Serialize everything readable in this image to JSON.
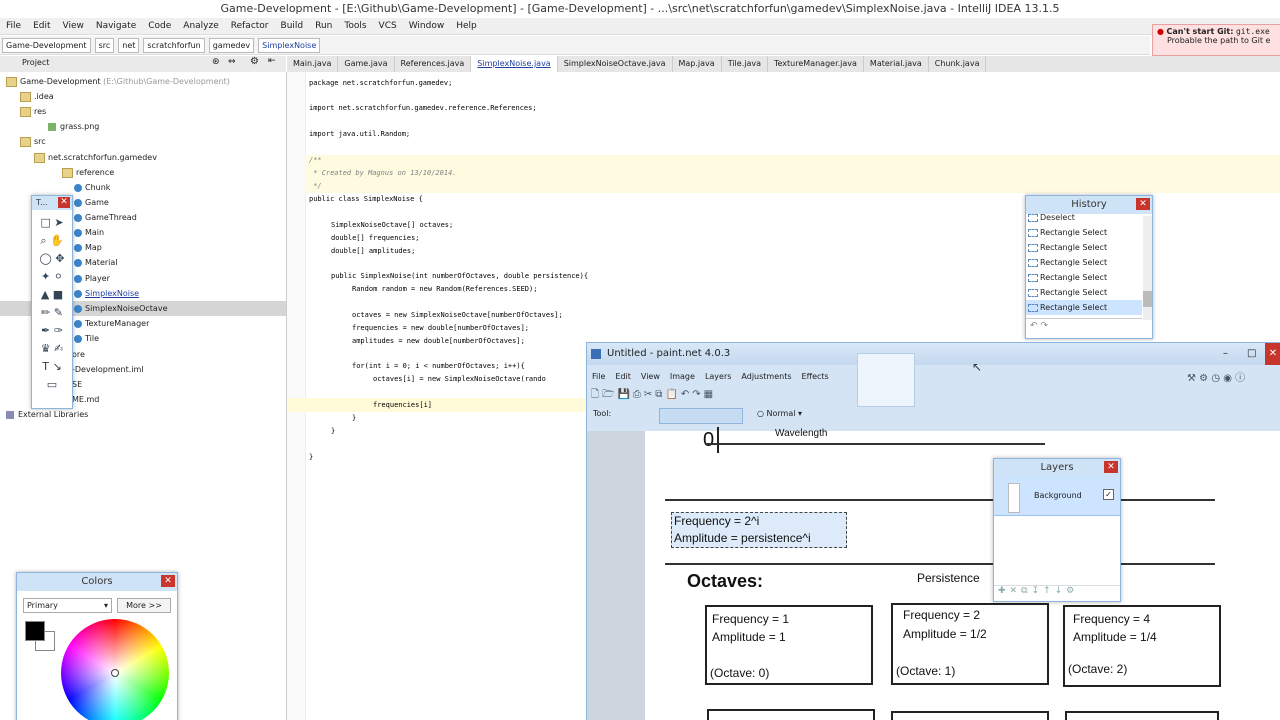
{
  "intellij": {
    "title": "Game-Development - [E:\\Github\\Game-Development] - [Game-Development] - ...\\src\\net\\scratchforfun\\gamedev\\SimplexNoise.java - IntelliJ IDEA 13.1.5",
    "menu": [
      "File",
      "Edit",
      "View",
      "Navigate",
      "Code",
      "Analyze",
      "Refactor",
      "Build",
      "Run",
      "Tools",
      "VCS",
      "Window",
      "Help"
    ],
    "breadcrumbs": [
      "Game-Development",
      "src",
      "net",
      "scratchforfun",
      "gamedev",
      "SimplexNoise"
    ],
    "git_error": {
      "title": "Can't start Git:",
      "detail": "Probable the path to Git e",
      "code": "git.exe"
    },
    "project_label": "Project",
    "tree": [
      {
        "label": "Game-Development",
        "extra": "(E:\\Github\\Game-Development)",
        "type": "folder"
      },
      {
        "label": ".idea",
        "type": "folder"
      },
      {
        "label": "res",
        "type": "folder"
      },
      {
        "label": "grass.png",
        "type": "file"
      },
      {
        "label": "src",
        "type": "folder"
      },
      {
        "label": "net.scratchforfun.gamedev",
        "type": "folder"
      },
      {
        "label": "reference",
        "type": "folder"
      },
      {
        "label": "Chunk",
        "type": "class"
      },
      {
        "label": "Game",
        "type": "class"
      },
      {
        "label": "GameThread",
        "type": "class"
      },
      {
        "label": "Main",
        "type": "class"
      },
      {
        "label": "Map",
        "type": "class"
      },
      {
        "label": "Material",
        "type": "class"
      },
      {
        "label": "Player",
        "type": "class"
      },
      {
        "label": "SimplexNoise",
        "type": "class"
      },
      {
        "label": "SimplexNoiseOctave",
        "type": "class"
      },
      {
        "label": "TextureManager",
        "type": "class"
      },
      {
        "label": "Tile",
        "type": "class"
      },
      {
        "label": "ore",
        "type": "file"
      },
      {
        "label": "-Development.iml",
        "type": "file"
      },
      {
        "label": "SE",
        "type": "file"
      },
      {
        "label": "ME.md",
        "type": "file"
      },
      {
        "label": "External Libraries",
        "type": "folder"
      }
    ],
    "tabs": [
      "Main.java",
      "Game.java",
      "References.java",
      "SimplexNoise.java",
      "SimplexNoiseOctave.java",
      "Map.java",
      "Tile.java",
      "TextureManager.java",
      "Material.java",
      "Chunk.java"
    ],
    "code": [
      "package net.scratchforfun.gamedev;",
      "import net.scratchforfun.gamedev.reference.References;",
      "import java.util.Random;",
      "/**",
      " * Created by Magnus on 13/10/2014.",
      " */",
      "public class SimplexNoise {",
      "SimplexNoiseOctave[] octaves;",
      "double[] frequencies;",
      "double[] amplitudes;",
      "public SimplexNoise(int numberOfOctaves, double persistence){",
      "Random random = new Random(References.SEED);",
      "octaves = new SimplexNoiseOctave[numberOfOctaves];",
      "frequencies = new double[numberOfOctaves];",
      "amplitudes = new double[numberOfOctaves];",
      "for(int i = 0; i < numberOfOctaves; i++){",
      "octaves[i] = new SimplexNoiseOctave(rando",
      "frequencies[i]",
      "}",
      "}",
      "}"
    ]
  },
  "paintnet": {
    "title": "Untitled - paint.net 4.0.3",
    "menu": [
      "File",
      "Edit",
      "View",
      "Image",
      "Layers",
      "Adjustments",
      "Effects"
    ],
    "tool_label": "Tool:",
    "blend_mode": "Normal",
    "history": {
      "title": "History",
      "items": [
        "Deselect",
        "Rectangle Select",
        "Rectangle Select",
        "Rectangle Select",
        "Rectangle Select",
        "Rectangle Select",
        "Rectangle Select"
      ]
    },
    "layers": {
      "title": "Layers",
      "items": [
        "Background"
      ]
    },
    "colors": {
      "title": "Colors",
      "mode": "Primary",
      "more": "More >>",
      "primary": "#000000",
      "secondary": "#ffffff"
    },
    "tools_title": "T..."
  },
  "canvas": {
    "wavelength": "Wavelength",
    "zero": "0",
    "freq_formula": "Frequency = 2^i",
    "amp_formula": "Amplitude = persistence^i",
    "octaves_heading": "Octaves:",
    "persistence": "Persistence",
    "boxes": [
      {
        "freq": "Frequency = 1",
        "amp": "Amplitude = 1",
        "octave": "(Octave: 0)"
      },
      {
        "freq": "Frequency = 2",
        "amp": "Amplitude = 1/2",
        "octave": "(Octave: 1)"
      },
      {
        "freq": "Frequency = 4",
        "amp": "Amplitude = 1/4",
        "octave": "(Octave: 2)"
      }
    ]
  }
}
